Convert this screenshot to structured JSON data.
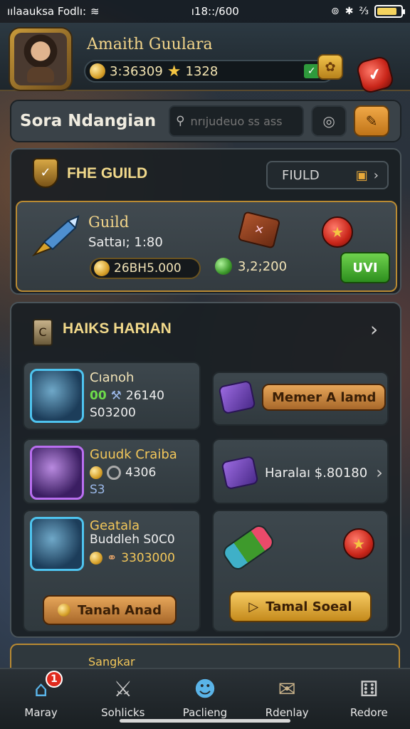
{
  "status_bar": {
    "carrier": "ıılaauksa Fodlı:",
    "time": "ı18::/600"
  },
  "header": {
    "player_name": "Amaith Guulara",
    "coins": "3:36309",
    "stars": "1328"
  },
  "search": {
    "page_title": "Sora Ndangian",
    "placeholder": "nrıjudeuo ss ass"
  },
  "guild": {
    "section_title": "FHE GUILD",
    "field_label": "FIULD",
    "name": "Guild",
    "status": "Sattaı; 1:80",
    "coins": "26BH5.000",
    "gems": "3,2;200",
    "join_label": "UVI"
  },
  "missions": {
    "section_title": "HAIKS HARIAN",
    "tiles": [
      {
        "title": "Cıanoh",
        "line1_a": "00",
        "line1_b": "26140",
        "line2": "S03200"
      },
      {
        "title": "Guudk Craiba",
        "line1_b": "4306",
        "line2": "S3"
      },
      {
        "title": "Geatala",
        "line1": "Buddleh S0C0",
        "line2": "3303000"
      }
    ],
    "side_items": [
      {
        "label": "Memer A lamd"
      },
      {
        "label": "Haralaı $.80180"
      }
    ],
    "action_left": "Tanah Anad",
    "action_right": "Tamal Soeal",
    "peek_label": "Sangkar"
  },
  "bottom_nav": [
    {
      "label": "Maray",
      "icon": "home-icon",
      "badge": "1"
    },
    {
      "label": "Sohlicks",
      "icon": "swords-icon"
    },
    {
      "label": "Paclieng",
      "icon": "mask-icon"
    },
    {
      "label": "Rdenlay",
      "icon": "scroll-icon"
    },
    {
      "label": "Redore",
      "icon": "dice-icon"
    }
  ],
  "colors": {
    "accent_gold": "#f3d58a",
    "border_gold": "#b98a32",
    "panel_bg": "#1a2024",
    "green": "#2d8f1e",
    "red": "#c9261a"
  }
}
